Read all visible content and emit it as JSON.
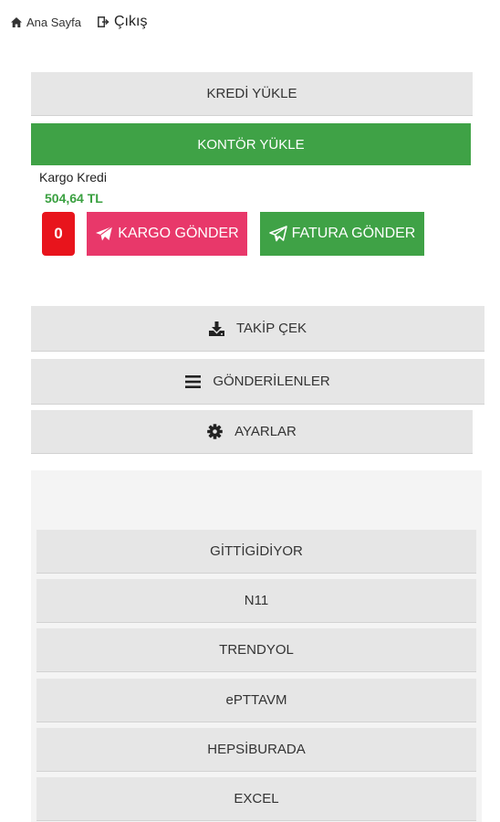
{
  "nav": {
    "home_label": "Ana Sayfa",
    "exit_label": "Çıkış"
  },
  "actions": {
    "kredi_yukle": "KREDİ YÜKLE",
    "kontor_yukle": "KONTÖR YÜKLE"
  },
  "credit": {
    "label": "Kargo Kredi",
    "value": "504,64 TL"
  },
  "badge_count": "0",
  "send": {
    "kargo_label": "KARGO GÖNDER",
    "fatura_label": "FATURA GÖNDER"
  },
  "menu": {
    "takip_cek": "TAKİP ÇEK",
    "gonderilenler": "GÖNDERİLENLER",
    "ayarlar": "AYARLAR"
  },
  "marketplaces": [
    "GİTTİGİDİYOR",
    "N11",
    "TRENDYOL",
    "ePTTAVM",
    "HEPSİBURADA",
    "EXCEL"
  ],
  "colors": {
    "green": "#3fa246",
    "pink": "#e8386a",
    "red": "#e8141c",
    "gray": "#e6e6e6"
  }
}
